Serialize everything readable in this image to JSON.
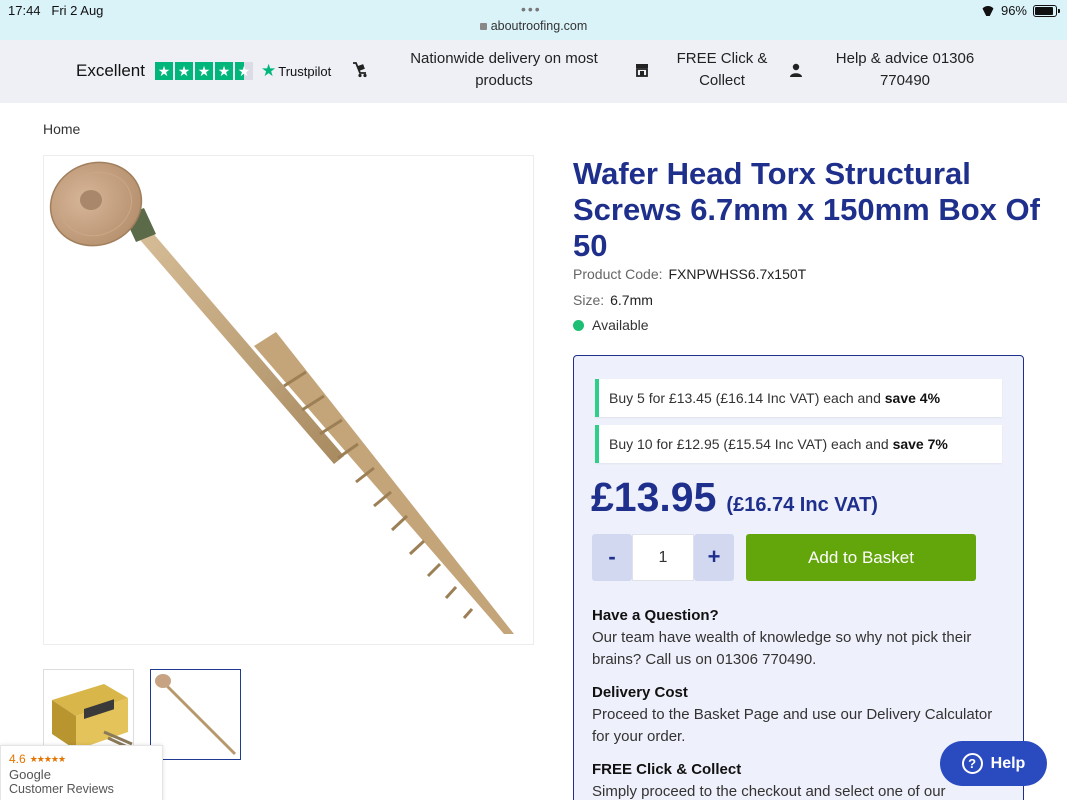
{
  "status_bar": {
    "time": "17:44",
    "date": "Fri 2 Aug",
    "url": "aboutroofing.com",
    "battery": "96%",
    "battery_level": 0.96
  },
  "usp_bar": {
    "trustpilot": {
      "rating_word": "Excellent",
      "brand": "Trustpilot",
      "stars_filled": 4.5,
      "star_color": "#00b67a"
    },
    "delivery": "Nationwide delivery on most products",
    "click_collect": "FREE Click & Collect",
    "help": "Help & advice 01306 770490"
  },
  "breadcrumb": {
    "home": "Home"
  },
  "product": {
    "title": "Wafer Head Torx Structural Screws 6.7mm x 150mm Box Of 50",
    "code_label": "Product Code:",
    "code": "FXNPWHSS6.7x150T",
    "size_label": "Size:",
    "size": "6.7mm",
    "availability": "Available"
  },
  "pricing": {
    "offers": [
      {
        "text": "Buy 5 for £13.45 (£16.14 Inc VAT) each and ",
        "save": "save 4%"
      },
      {
        "text": "Buy 10 for £12.95 (£15.54 Inc VAT) each and ",
        "save": "save 7%"
      }
    ],
    "price": "£13.95",
    "price_vat": "(£16.74 Inc VAT)",
    "qty_minus": "-",
    "qty_value": "1",
    "qty_plus": "+",
    "add_button": "Add to Basket"
  },
  "info": {
    "question_h": "Have a Question?",
    "question_p": "Our team have wealth of knowledge so why not pick their brains? Call us on 01306 770490.",
    "delivery_h": "Delivery Cost",
    "delivery_p": "Proceed to the Basket Page and use our Delivery Calculator for your order.",
    "collect_h": "FREE Click & Collect",
    "collect_p": "Simply proceed to the checkout and select one of our"
  },
  "google_badge": {
    "rating": "4.6",
    "google": "Google",
    "reviews": "Customer Reviews"
  },
  "help_button": {
    "label": "Help"
  },
  "colors": {
    "brand_navy": "#1e2f8c",
    "add_button_green": "#63a60c",
    "offer_accent": "#2ecf8a",
    "available_dot": "#1cbf74",
    "help_blue": "#2a4bbf"
  }
}
